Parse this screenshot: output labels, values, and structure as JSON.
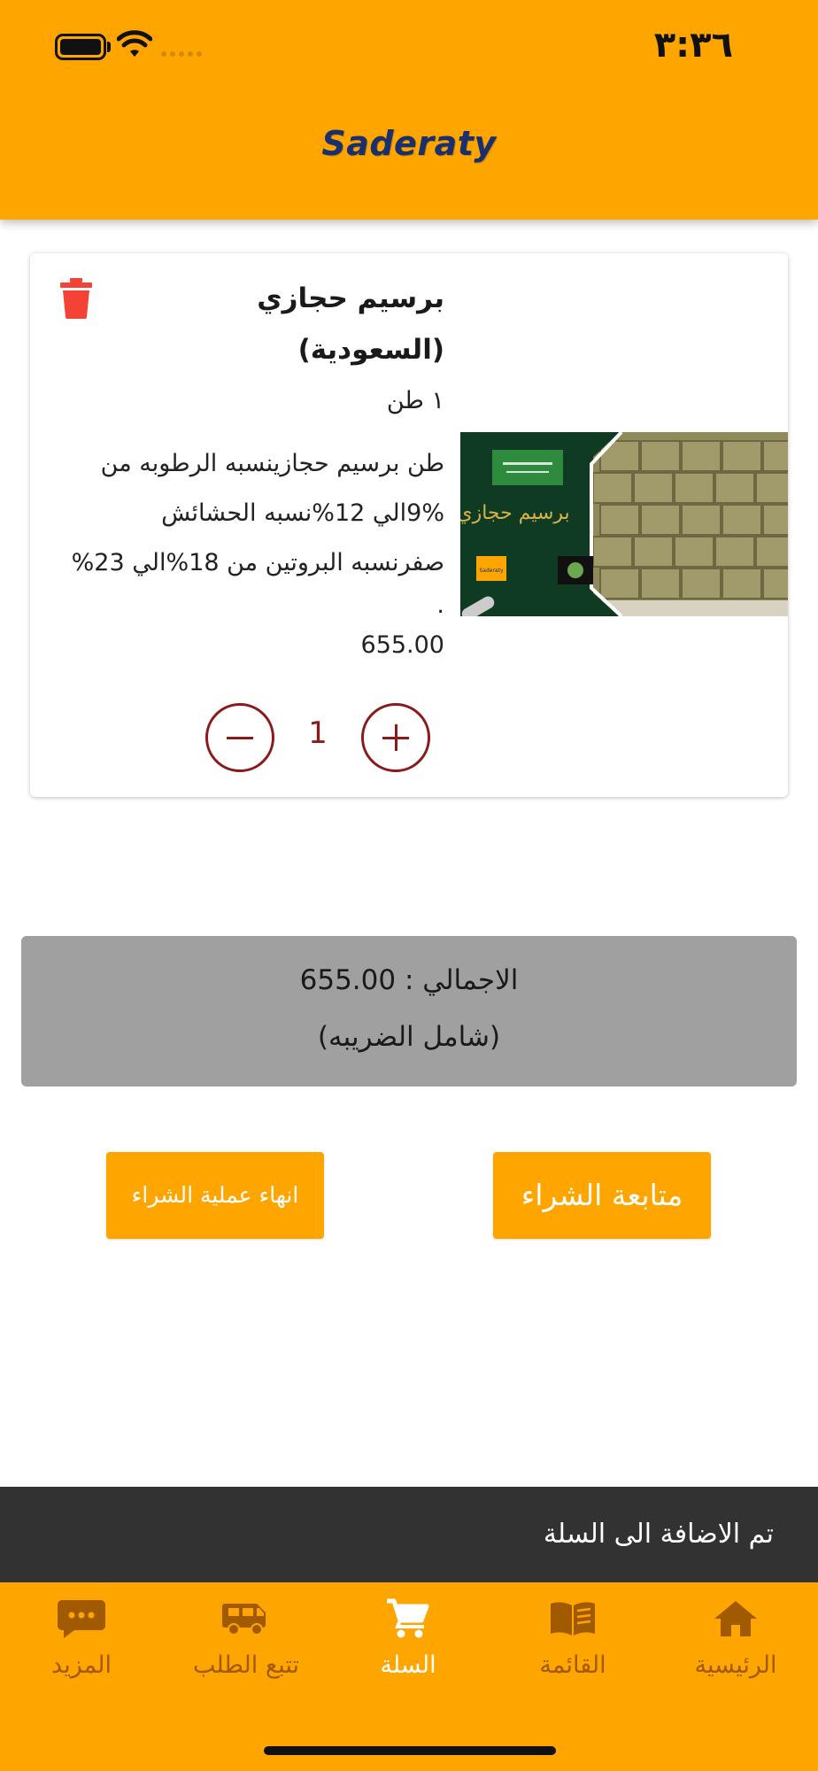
{
  "status_bar": {
    "time": "٣:٣٦"
  },
  "header": {
    "logo_text": "Saderaty"
  },
  "cart_item": {
    "name": "برسيم حجازي",
    "origin": "(السعودية)",
    "unit": "١ طن",
    "description_lines": [
      "طن برسيم حجازينسبه الرطوبه من",
      "9%الي 12%نسبه الحشائش",
      "صفرنسبه البروتين من 18%الي 23%",
      "."
    ],
    "price": "655.00",
    "quantity": "1",
    "image": {
      "banner_text": "برسيم حجازي",
      "logo_text": "Saderaty"
    }
  },
  "total": {
    "label_line": "الاجمالي : 655.00",
    "tax_note": "(شامل الضريبه)"
  },
  "actions": {
    "finish_label": "انهاء عملية الشراء",
    "continue_label": "متابعة الشراء"
  },
  "snackbar": {
    "message": "تم الاضافة الى السلة"
  },
  "bottom_nav": {
    "items": [
      {
        "label": "المزيد",
        "icon": "more-chat-icon"
      },
      {
        "label": "تتبع الطلب",
        "icon": "truck-icon"
      },
      {
        "label": "السلة",
        "icon": "cart-icon",
        "active": true
      },
      {
        "label": "القائمة",
        "icon": "book-icon"
      },
      {
        "label": "الرئيسية",
        "icon": "home-icon"
      }
    ]
  },
  "colors": {
    "accent": "#FFA500",
    "danger": "#F44336",
    "quantity": "#8B1A1A",
    "total_bg": "#A0A0A0",
    "snackbar_bg": "#323232"
  }
}
